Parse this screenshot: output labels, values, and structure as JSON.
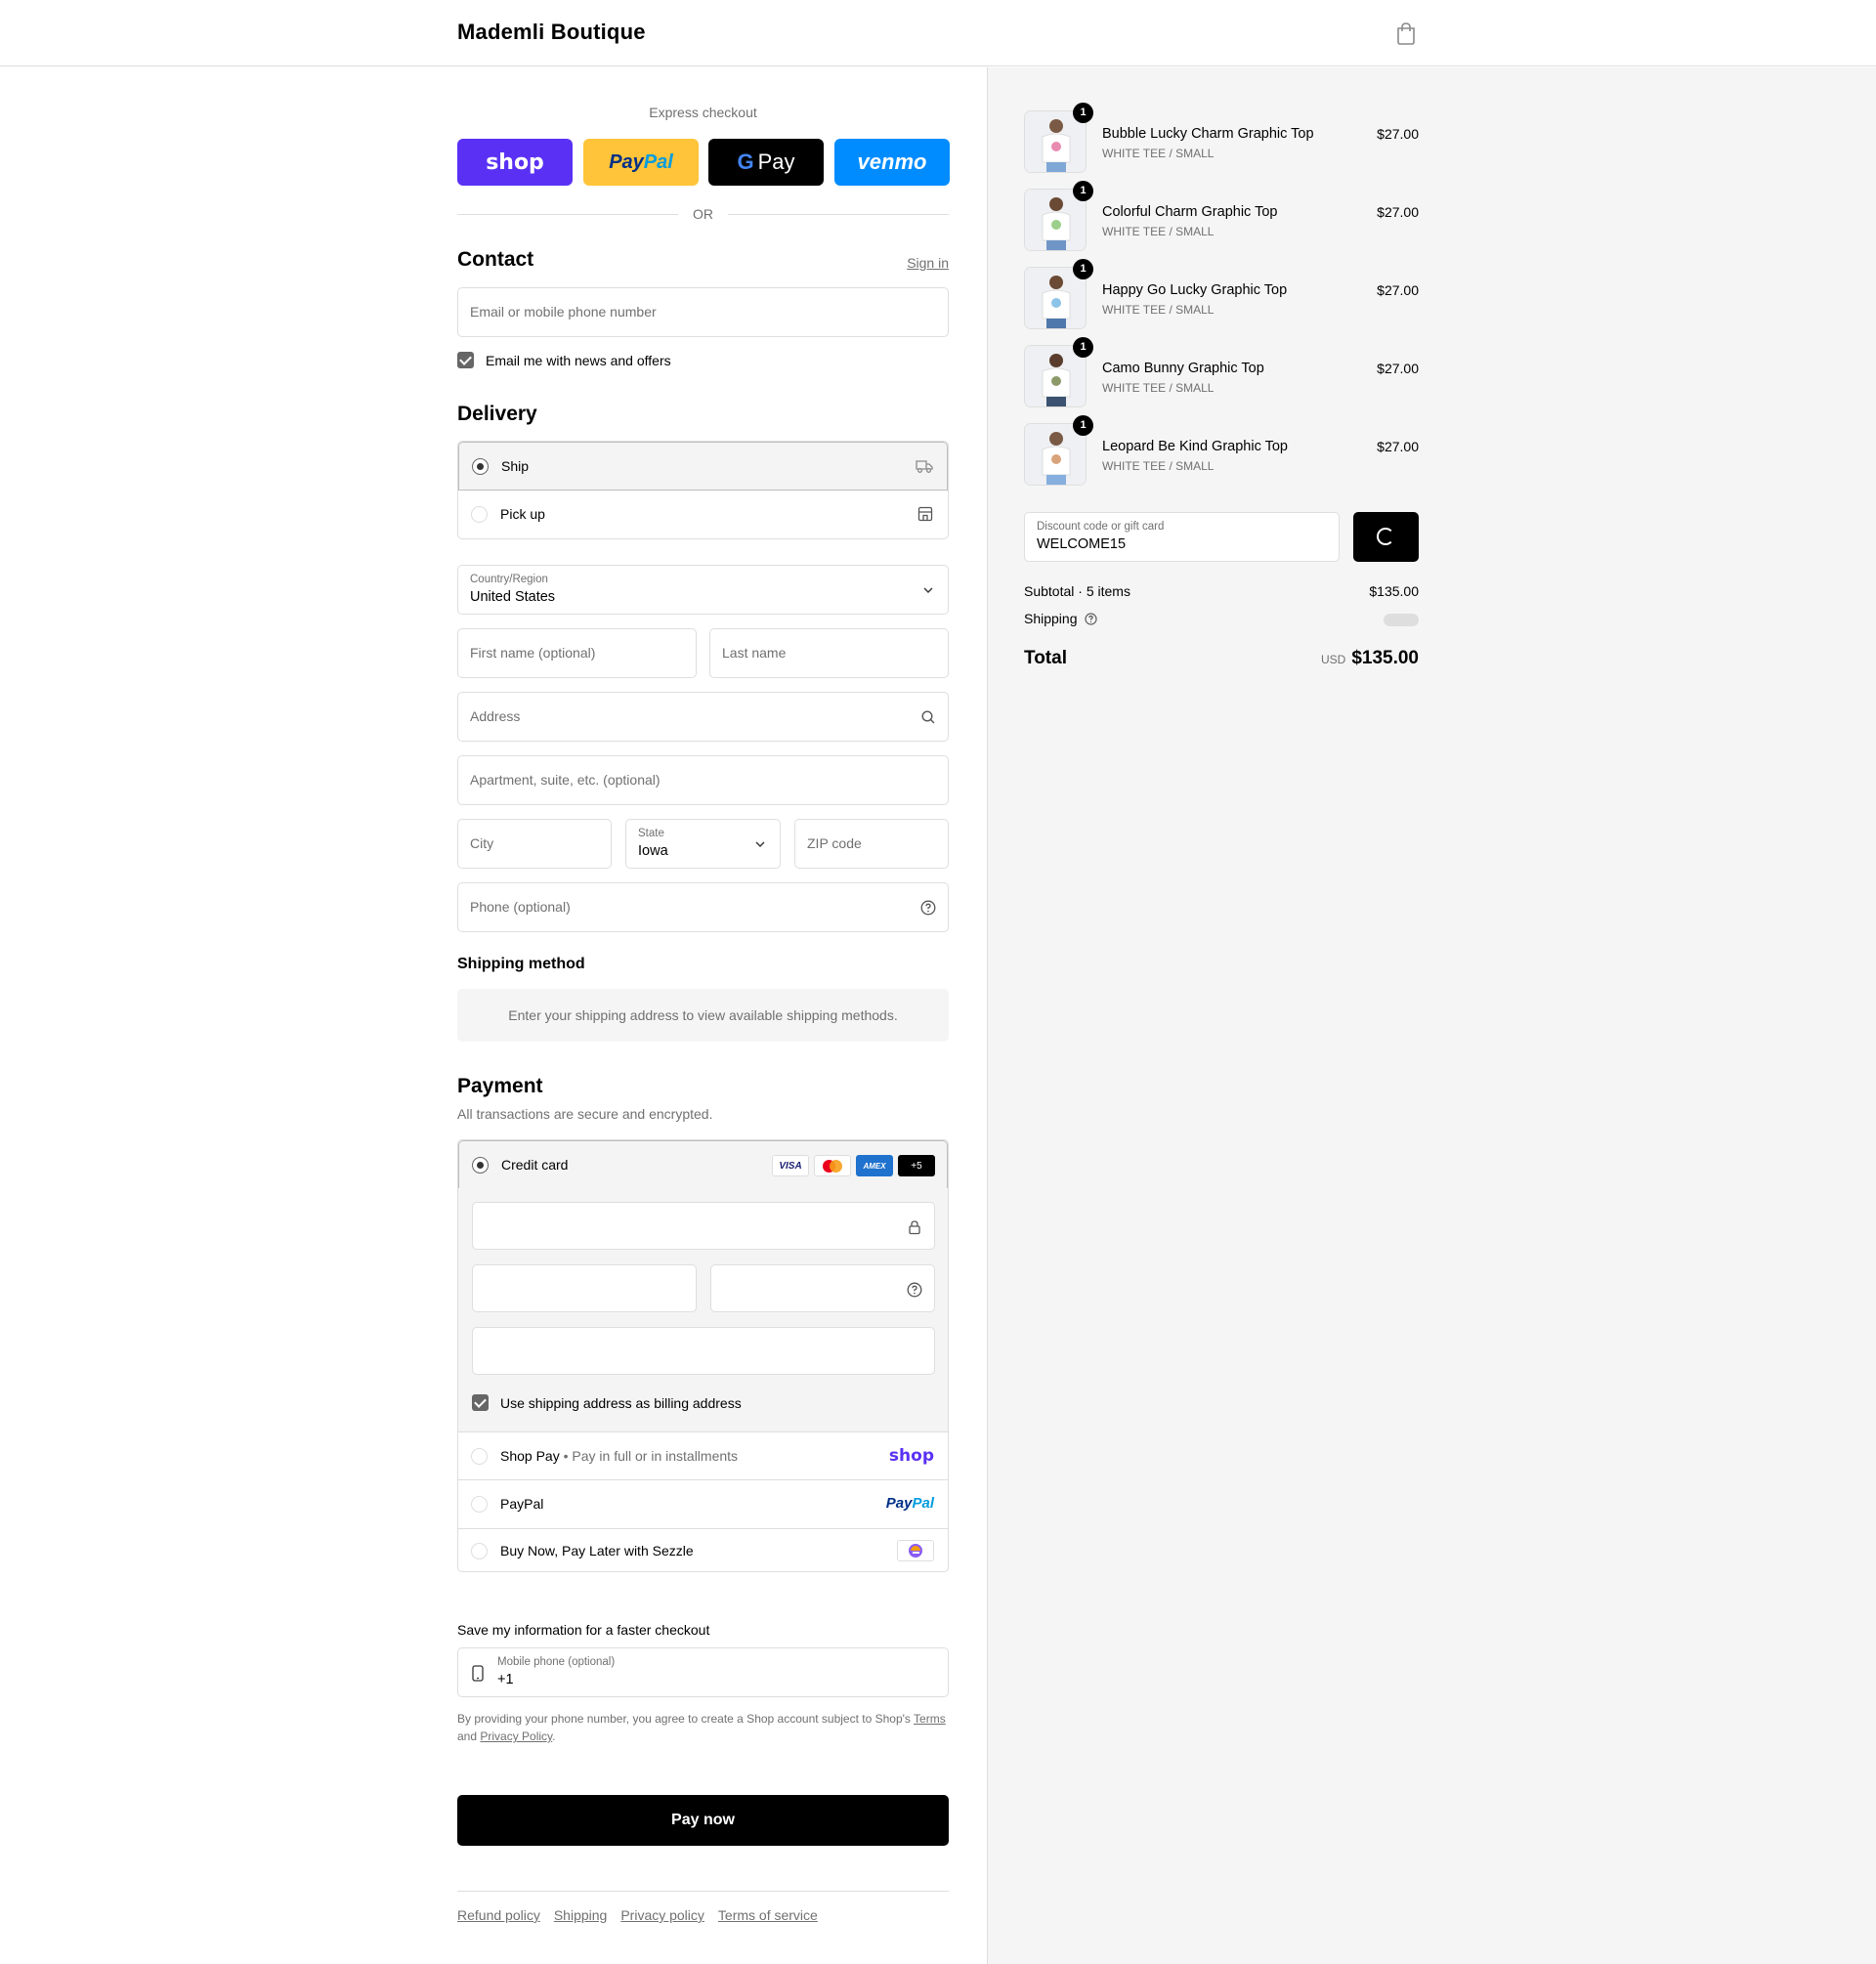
{
  "header": {
    "brand": "Mademli Boutique",
    "bag_icon": "shopping-bag-icon"
  },
  "express": {
    "title": "Express checkout",
    "buttons": {
      "shop": "shop",
      "paypal_1": "Pay",
      "paypal_2": "Pal",
      "gpay_g": "G",
      "gpay": "Pay",
      "venmo": "venmo"
    },
    "or": "OR"
  },
  "contact": {
    "title": "Contact",
    "signin": "Sign in",
    "email_placeholder": "Email or mobile phone number",
    "news_label": "Email me with news and offers",
    "news_checked": true
  },
  "delivery": {
    "title": "Delivery",
    "options": [
      {
        "label": "Ship",
        "icon": "truck-icon",
        "selected": true
      },
      {
        "label": "Pick up",
        "icon": "store-icon",
        "selected": false
      }
    ],
    "country_label": "Country/Region",
    "country_value": "United States",
    "first_name_placeholder": "First name (optional)",
    "last_name_placeholder": "Last name",
    "address_placeholder": "Address",
    "apartment_placeholder": "Apartment, suite, etc. (optional)",
    "city_placeholder": "City",
    "state_label": "State",
    "state_value": "Iowa",
    "zip_placeholder": "ZIP code",
    "phone_placeholder": "Phone (optional)"
  },
  "shipping_method": {
    "title": "Shipping method",
    "note": "Enter your shipping address to view available shipping methods."
  },
  "payment": {
    "title": "Payment",
    "subtitle": "All transactions are secure and encrypted.",
    "credit_card_label": "Credit card",
    "card_brands": [
      "VISA",
      "",
      "AMEX",
      "+5"
    ],
    "billing_label": "Use shipping address as billing address",
    "billing_checked": true,
    "shop_pay_label": "Shop Pay",
    "shop_pay_sub": "Pay in full or in installments",
    "shop_pay_logo": "shop",
    "paypal_label": "PayPal",
    "paypal_logo_1": "Pay",
    "paypal_logo_2": "Pal",
    "sezzle_label": "Buy Now, Pay Later with Sezzle"
  },
  "save_info": {
    "title": "Save my information for a faster checkout",
    "mobile_label": "Mobile phone (optional)",
    "mobile_value": "+1",
    "legal_text": "By providing your phone number, you agree to create a Shop account subject to Shop's",
    "terms": "Terms",
    "and": "and",
    "privacy": "Privacy Policy",
    "period": "."
  },
  "pay_now": "Pay now",
  "footer_links": [
    "Refund policy",
    "Shipping",
    "Privacy policy",
    "Terms of service"
  ],
  "summary": {
    "items": [
      {
        "qty": "1",
        "name": "Bubble Lucky Charm Graphic Top",
        "variant": "WHITE TEE / SMALL",
        "price": "$27.00"
      },
      {
        "qty": "1",
        "name": "Colorful Charm Graphic Top",
        "variant": "WHITE TEE / SMALL",
        "price": "$27.00"
      },
      {
        "qty": "1",
        "name": "Happy Go Lucky Graphic Top",
        "variant": "WHITE TEE / SMALL",
        "price": "$27.00"
      },
      {
        "qty": "1",
        "name": "Camo Bunny Graphic Top",
        "variant": "WHITE TEE / SMALL",
        "price": "$27.00"
      },
      {
        "qty": "1",
        "name": "Leopard Be Kind Graphic Top",
        "variant": "WHITE TEE / SMALL",
        "price": "$27.00"
      }
    ],
    "discount_label": "Discount code or gift card",
    "discount_value": "WELCOME15",
    "subtotal_label": "Subtotal · 5 items",
    "subtotal_value": "$135.00",
    "shipping_label": "Shipping",
    "total_label": "Total",
    "currency": "USD",
    "total_value": "$135.00"
  },
  "colors": {
    "shop_purple": "#5a31f4",
    "paypal_yellow": "#ffc439",
    "venmo_blue": "#008cff",
    "accent_black": "#000000"
  }
}
